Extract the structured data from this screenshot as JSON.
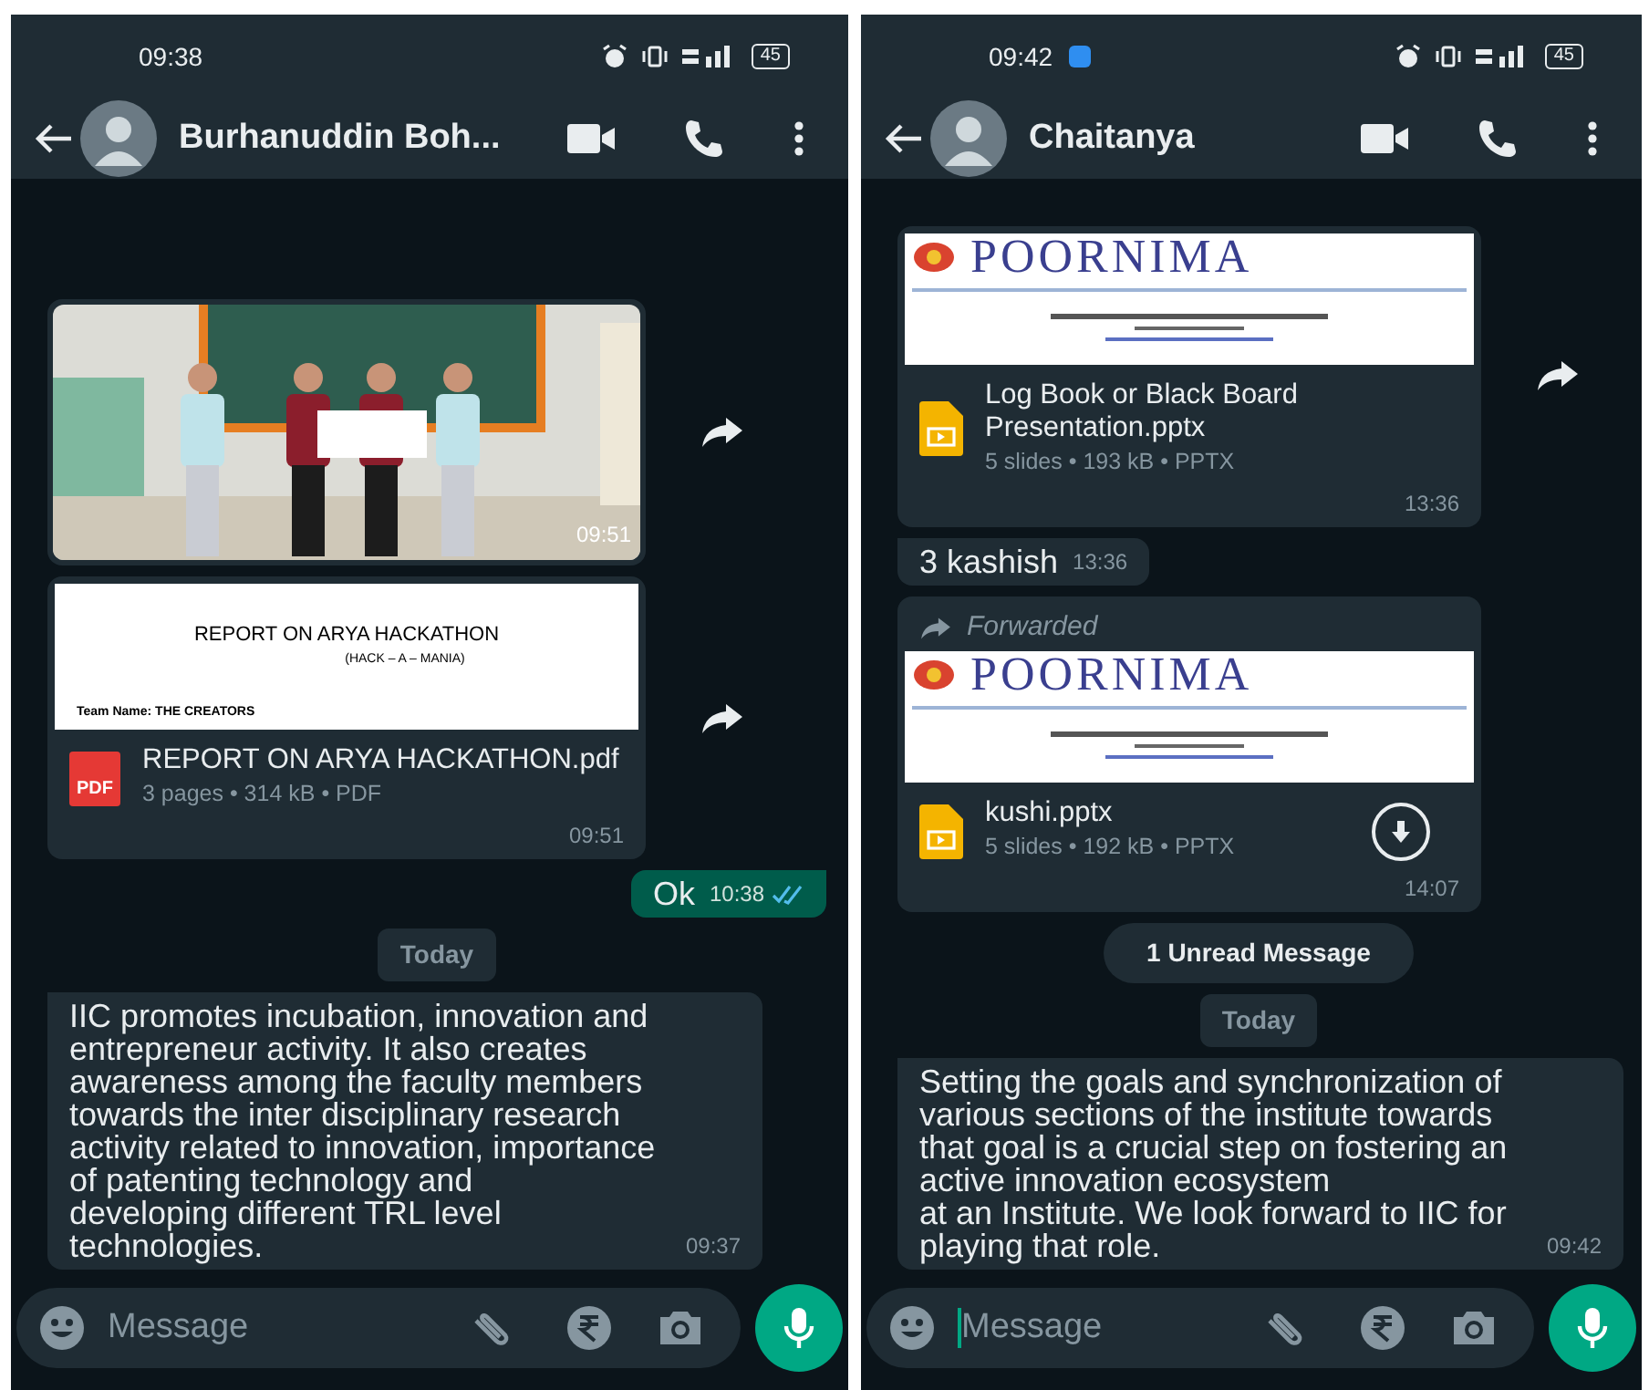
{
  "phones": [
    {
      "status_bar": {
        "time": "09:38",
        "notification": false,
        "battery": "45"
      },
      "header": {
        "name": "Burhanuddin Boh..."
      },
      "messages": [
        {
          "time": "09:51",
          "forward_button": true
        },
        {
          "kind": "pdf_document",
          "preview": {
            "kind": "report",
            "title": "REPORT ON ARYA HACKATHON",
            "subtitle": "(HACK – A – MANIA)",
            "note": "Team Name: THE CREATORS"
          },
          "file_icon_label": "PDF",
          "name": "REPORT ON ARYA HACKATHON.pdf",
          "meta": "3 pages • 314 kB • PDF",
          "time": "09:51",
          "forward_button": true,
          "forwarded": false,
          "download_button": false
        },
        {
          "kind": "text",
          "outgoing": true,
          "text": "Ok",
          "time": "10:38",
          "read": true
        },
        {
          "kind": "date",
          "text": "Today"
        },
        {
          "kind": "text",
          "outgoing": false,
          "text": "IIC promotes incubation, innovation and entrepreneur activity. It also creates\nawareness among the faculty members towards the inter disciplinary research\nactivity related to innovation, importance of patenting technology and\ndeveloping different TRL level technologies.",
          "time": "09:37"
        }
      ],
      "composer": {
        "placeholder": "Message",
        "focused": false
      }
    },
    {
      "status_bar": {
        "time": "09:42",
        "notification": true,
        "battery": "45"
      },
      "header": {
        "name": "Chaitanya"
      },
      "messages": [
        {
          "kind": "slides_document",
          "preview": {
            "kind": "letterhead",
            "title": "POORNIMA"
          },
          "name": "Log Book or Black Board Presentation.pptx",
          "meta": "5 slides • 193 kB • PPTX",
          "time": "13:36",
          "forward_button": true,
          "forwarded": false,
          "download_button": false
        },
        {
          "kind": "text",
          "outgoing": false,
          "text": "3 kashish",
          "time": "13:36"
        },
        {
          "kind": "slides_document",
          "preview": {
            "kind": "letterhead",
            "title": "POORNIMA"
          },
          "name": "kushi.pptx",
          "meta": "5 slides • 192 kB • PPTX",
          "time": "14:07",
          "forward_button": false,
          "forwarded": true,
          "forwarded_label": "Forwarded",
          "download_button": true
        },
        {
          "kind": "unread",
          "text": "1 Unread Message"
        },
        {
          "kind": "date",
          "text": "Today"
        },
        {
          "kind": "text",
          "outgoing": false,
          "text": "Setting the goals and synchronization of various sections of the institute towards that goal is a crucial step on fostering an active innovation ecosystem\nat an Institute. We look forward to IIC for playing that role.",
          "time": "09:42"
        }
      ],
      "composer": {
        "placeholder": "Message",
        "focused": true
      }
    }
  ]
}
